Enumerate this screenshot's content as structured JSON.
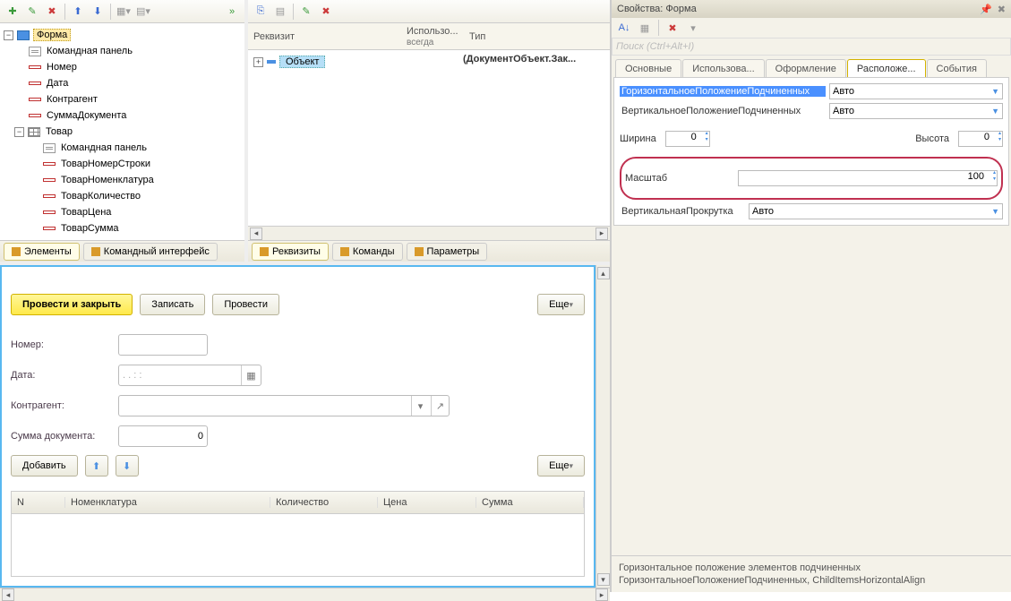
{
  "tree": {
    "root": "Форма",
    "items": [
      "Командная панель",
      "Номер",
      "Дата",
      "Контрагент",
      "СуммаДокумента"
    ],
    "group": "Товар",
    "group_items": [
      "Командная панель",
      "ТоварНомерСтроки",
      "ТоварНоменклатура",
      "ТоварКоличество",
      "ТоварЦена",
      "ТоварСумма"
    ]
  },
  "tree_tabs": {
    "a": "Элементы",
    "b": "Командный интерфейс"
  },
  "req": {
    "cols": {
      "a": "Реквизит",
      "b": "Использо...",
      "b2": "всегда",
      "c": "Тип"
    },
    "obj": "Объект",
    "obj_type": "(ДокументОбъект.Зак..."
  },
  "req_tabs": {
    "a": "Реквизиты",
    "b": "Команды",
    "c": "Параметры"
  },
  "preview": {
    "btn_primary": "Провести и закрыть",
    "btn_save": "Записать",
    "btn_post": "Провести",
    "btn_more": "Еще",
    "labels": {
      "num": "Номер:",
      "date": "Дата:",
      "contr": "Контрагент:",
      "sum": "Сумма документа:"
    },
    "date_placeholder": ".  .       :  :",
    "sum_value": "0",
    "btn_add": "Добавить",
    "tbl": {
      "n": "N",
      "nom": "Номенклатура",
      "qty": "Количество",
      "price": "Цена",
      "sum": "Сумма"
    }
  },
  "props": {
    "title": "Свойства: Форма",
    "search_ph": "Поиск (Ctrl+Alt+I)",
    "tabs": [
      "Основные",
      "Использова...",
      "Оформление",
      "Расположе...",
      "События"
    ],
    "rows": {
      "h_align": {
        "l": "ГоризонтальноеПоложениеПодчиненных",
        "v": "Авто"
      },
      "v_align": {
        "l": "ВертикальноеПоложениеПодчиненных",
        "v": "Авто"
      },
      "width": {
        "l": "Ширина",
        "v": "0"
      },
      "height": {
        "l": "Высота",
        "v": "0"
      },
      "scale": {
        "l": "Масштаб",
        "v": "100"
      },
      "vscroll": {
        "l": "ВертикальнаяПрокрутка",
        "v": "Авто"
      }
    },
    "footer1": "Горизонтальное положение элементов подчиненных",
    "footer2": "ГоризонтальноеПоложениеПодчиненных, ChildItemsHorizontalAlign"
  }
}
